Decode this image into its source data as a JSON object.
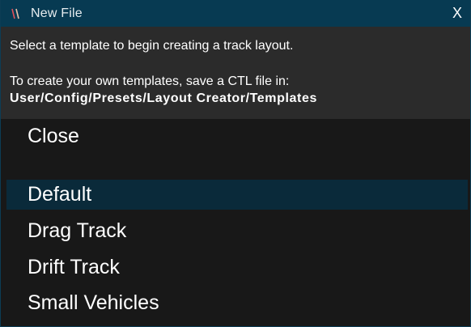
{
  "window": {
    "title": "New File",
    "close_label": "X",
    "icon": "app-glyph-icon"
  },
  "info": {
    "line1": "Select a template to begin creating a track layout.",
    "line2": "To create your own templates, save a CTL file in:",
    "path": "User/Config/Presets/Layout Creator/Templates"
  },
  "list": {
    "close_label": "Close",
    "items": [
      {
        "label": "Default",
        "selected": true
      },
      {
        "label": "Drag Track",
        "selected": false
      },
      {
        "label": "Drift Track",
        "selected": false
      },
      {
        "label": "Small Vehicles",
        "selected": false
      }
    ]
  },
  "colors": {
    "titlebar": "#073a52",
    "selected_row": "#0a2a3a",
    "info_panel": "#2b2b2b",
    "list_bg": "#181818",
    "icon_accent": "#e0505a"
  }
}
